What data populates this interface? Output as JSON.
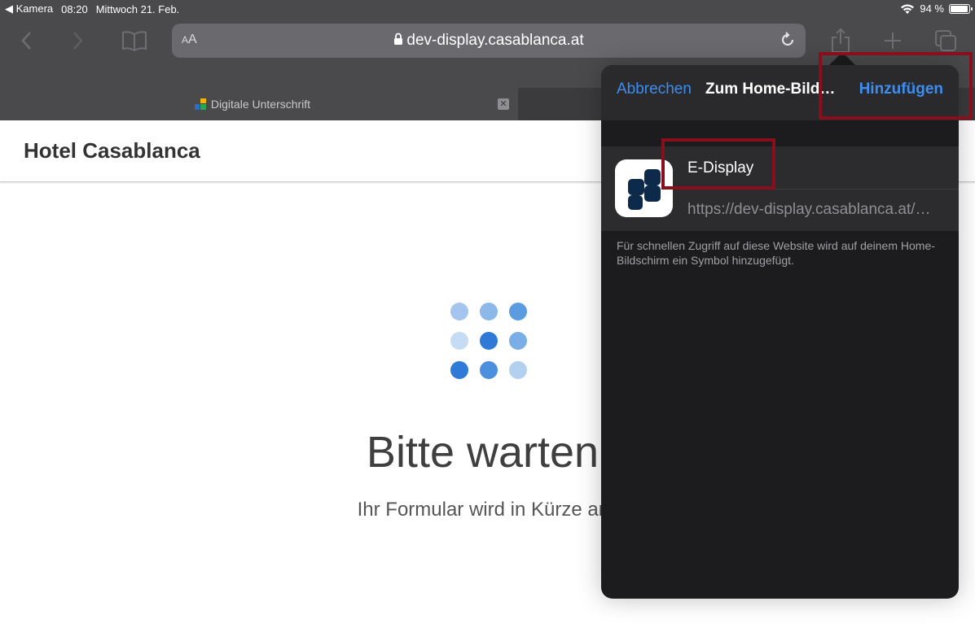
{
  "status_bar": {
    "back_app": "◀ Kamera",
    "time": "08:20",
    "date": "Mittwoch 21. Feb.",
    "battery": "94 %",
    "battery_level": 0.94
  },
  "toolbar": {
    "text_size_label": "AA",
    "url": "dev-display.casablanca.at"
  },
  "tab": {
    "title": "Digitale Unterschrift"
  },
  "page": {
    "brand": "Hotel Casablanca",
    "wait_title": "Bitte warten.",
    "wait_subtitle": "Ihr Formular wird in Kürze ang"
  },
  "popover": {
    "cancel": "Abbrechen",
    "title": "Zum Home-Bild…",
    "add": "Hinzufügen",
    "app_name": "E-Display",
    "app_url": "https://dev-display.casablanca.at/…",
    "hint": "Für schnellen Zugriff auf diese Website wird auf deinem Home-Bildschirm ein Symbol hinzugefügt."
  },
  "colors": {
    "accent_blue": "#3d8ef0",
    "highlight": "#8a0f1c",
    "dark_bg": "#1c1c1e"
  }
}
